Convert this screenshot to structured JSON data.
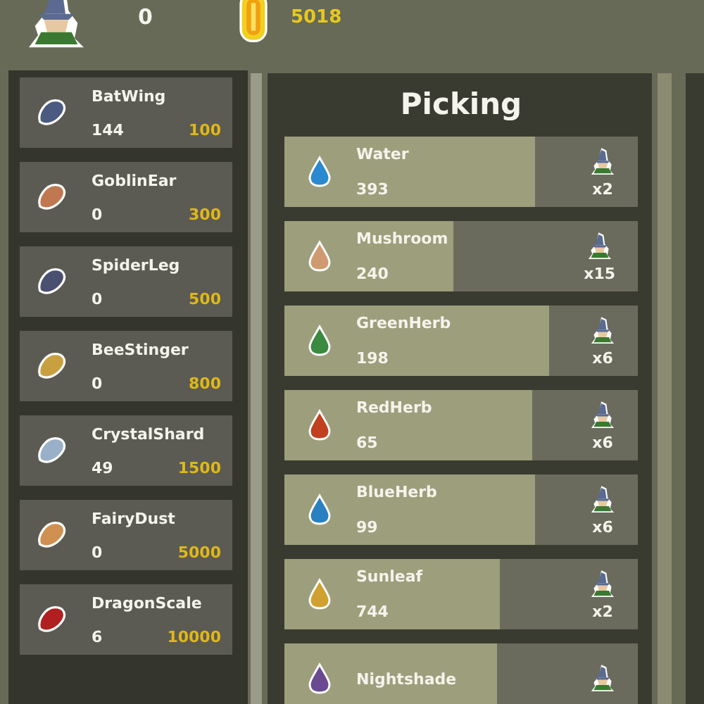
{
  "header": {
    "wizards": "0",
    "coins": "5018"
  },
  "inventory": [
    {
      "name": "BatWing",
      "owned": "144",
      "price": "100"
    },
    {
      "name": "GoblinEar",
      "owned": "0",
      "price": "300"
    },
    {
      "name": "SpiderLeg",
      "owned": "0",
      "price": "500"
    },
    {
      "name": "BeeStinger",
      "owned": "0",
      "price": "800"
    },
    {
      "name": "CrystalShard",
      "owned": "49",
      "price": "1500"
    },
    {
      "name": "FairyDust",
      "owned": "0",
      "price": "5000"
    },
    {
      "name": "DragonScale",
      "owned": "6",
      "price": "10000"
    }
  ],
  "picking": {
    "title": "Picking",
    "rows": [
      {
        "name": "Water",
        "amount": "393",
        "level": 0.71,
        "workers": "x2"
      },
      {
        "name": "Mushroom",
        "amount": "240",
        "level": 0.48,
        "workers": "x15"
      },
      {
        "name": "GreenHerb",
        "amount": "198",
        "level": 0.75,
        "workers": "x6"
      },
      {
        "name": "RedHerb",
        "amount": "65",
        "level": 0.7,
        "workers": "x6"
      },
      {
        "name": "BlueHerb",
        "amount": "99",
        "level": 0.71,
        "workers": "x6"
      },
      {
        "name": "Sunleaf",
        "amount": "744",
        "level": 0.61,
        "workers": "x2"
      },
      {
        "name": "Nightshade",
        "amount": "",
        "level": 0.6,
        "workers": ""
      }
    ]
  }
}
